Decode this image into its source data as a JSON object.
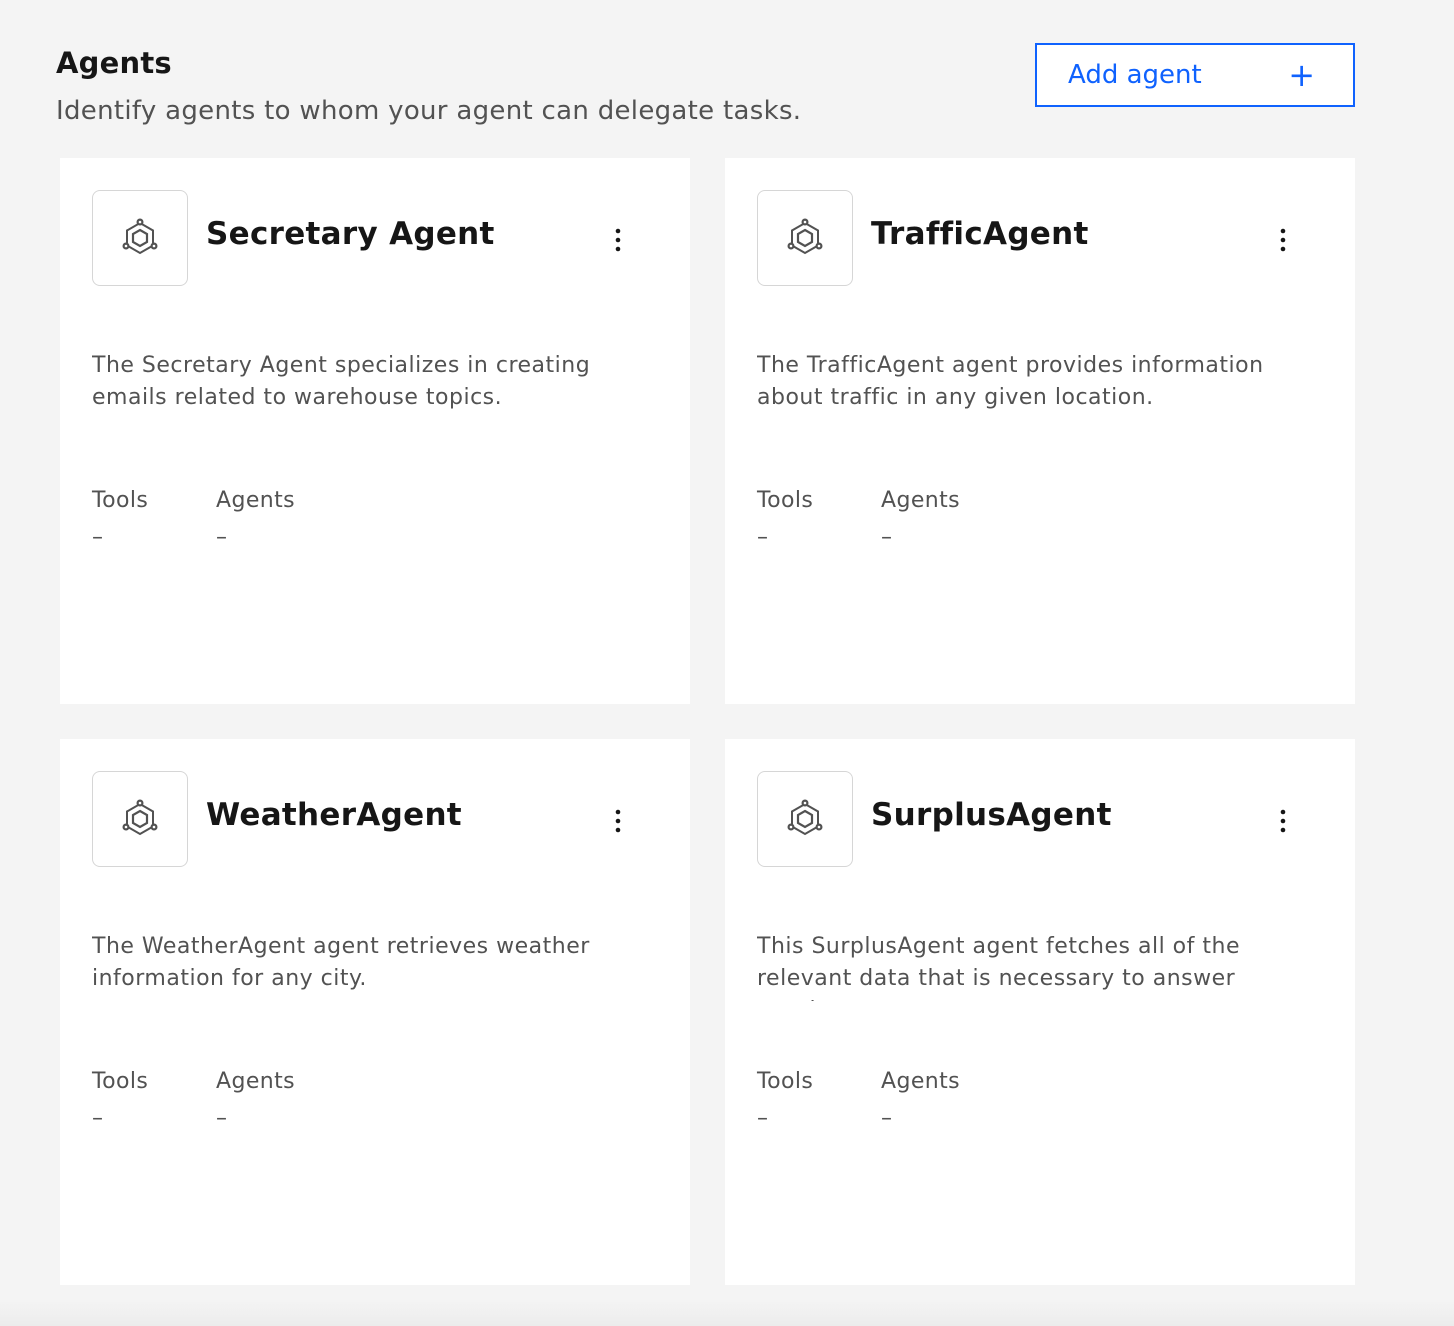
{
  "header": {
    "title": "Agents",
    "subtitle": "Identify agents to whom your agent can delegate tasks.",
    "add_button_label": "Add agent",
    "add_button_icon": "+"
  },
  "colors": {
    "accent": "#0f62fe",
    "background": "#f4f4f4",
    "card": "#ffffff",
    "text_primary": "#161616",
    "text_secondary": "#525252"
  },
  "cards": [
    {
      "name": "Secretary Agent",
      "icon": "agent-hexagon-icon",
      "description": "The Secretary Agent specializes in creating emails related to warehouse topics.",
      "tools_label": "Tools",
      "tools_value": "–",
      "agents_label": "Agents",
      "agents_value": "–"
    },
    {
      "name": "TrafficAgent",
      "icon": "agent-hexagon-icon",
      "description": "The TrafficAgent agent provides information about traffic in any given location.",
      "tools_label": "Tools",
      "tools_value": "–",
      "agents_label": "Agents",
      "agents_value": "–"
    },
    {
      "name": "WeatherAgent",
      "icon": "agent-hexagon-icon",
      "description": "The WeatherAgent agent retrieves weather information for any city.",
      "tools_label": "Tools",
      "tools_value": "–",
      "agents_label": "Agents",
      "agents_value": "–"
    },
    {
      "name": "SurplusAgent",
      "icon": "agent-hexagon-icon",
      "description": "This SurplusAgent agent fetches all of the relevant data that is necessary to answer querie...",
      "tools_label": "Tools",
      "tools_value": "–",
      "agents_label": "Agents",
      "agents_value": "–"
    }
  ]
}
